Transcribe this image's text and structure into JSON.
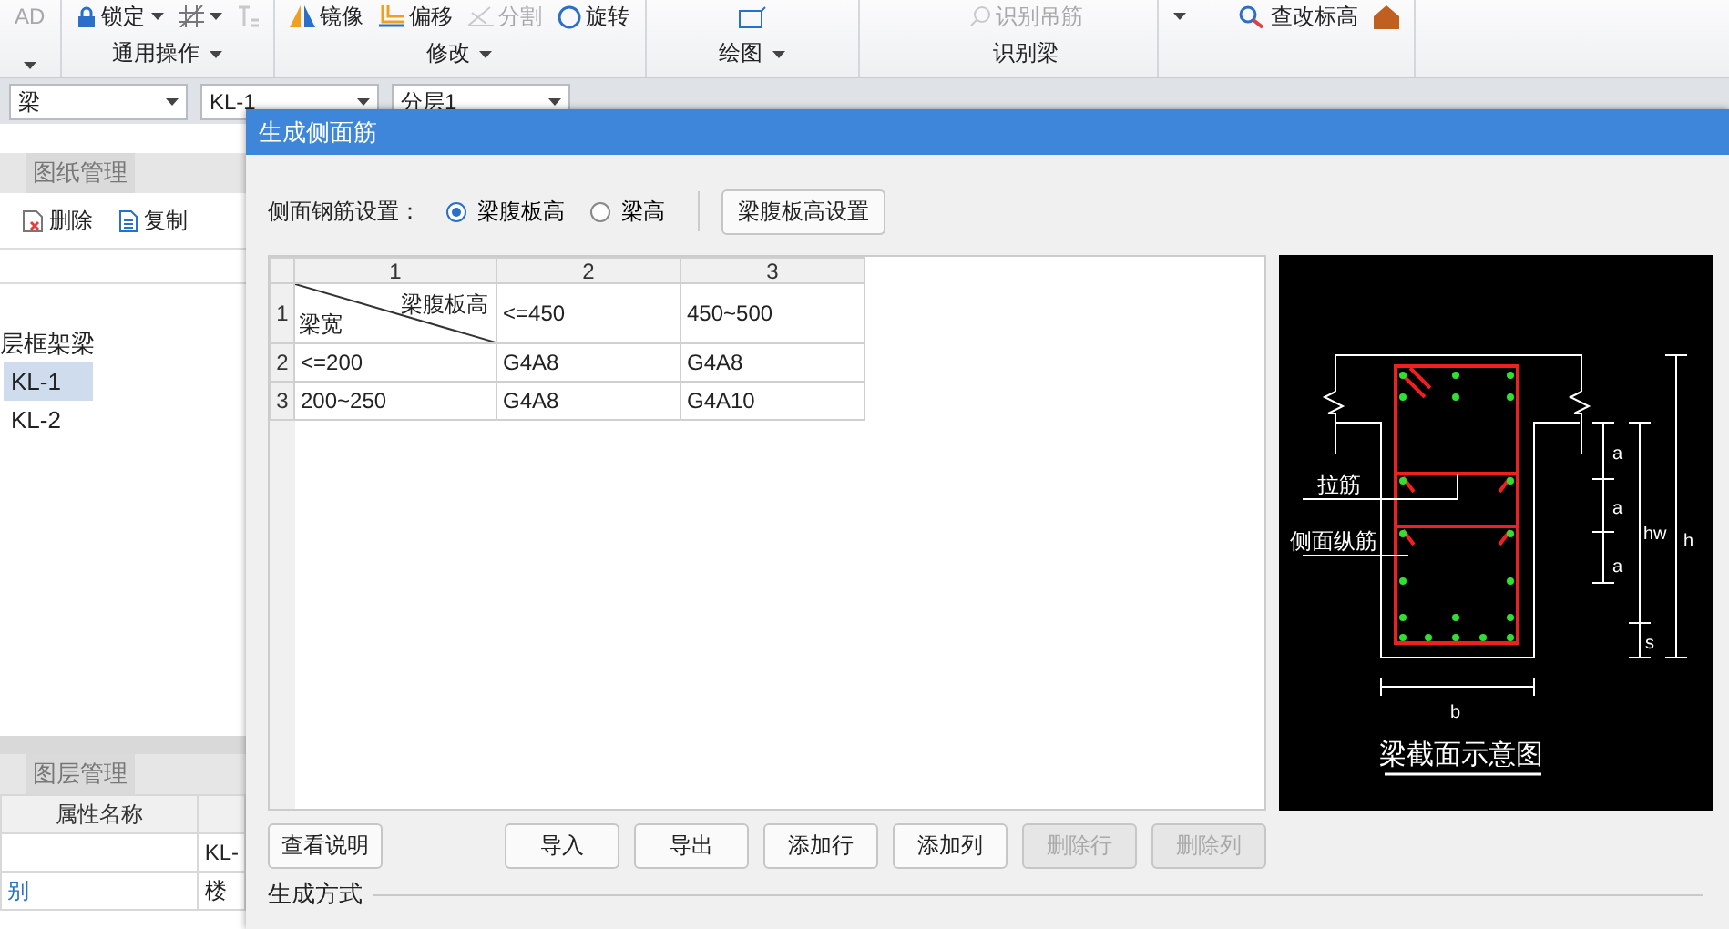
{
  "ribbon_groups": [
    {
      "tools": [
        {
          "kind": "labeled",
          "label": "AD",
          "disabled": true
        }
      ],
      "menu": true
    },
    {
      "label": "通用操作",
      "menu": true,
      "tools": [
        {
          "kind": "labeled",
          "label": "锁定",
          "disabled": false,
          "menu": true
        },
        {
          "kind": "icon",
          "disabled": false,
          "menu": true
        },
        {
          "kind": "icon",
          "disabled": true
        }
      ]
    },
    {
      "label": "修改",
      "menu": true,
      "tools": [
        {
          "kind": "labeled",
          "label": "镜像",
          "disabled": false
        },
        {
          "kind": "labeled",
          "label": "偏移",
          "disabled": false
        },
        {
          "kind": "labeled",
          "label": "分割",
          "disabled": true
        },
        {
          "kind": "labeled",
          "label": "旋转",
          "disabled": false
        }
      ]
    },
    {
      "label": "绘图",
      "menu": true,
      "tools": [
        {
          "kind": "icon",
          "disabled": false
        }
      ]
    },
    {
      "label": "识别梁",
      "tools": [
        {
          "kind": "labeled",
          "label": "识别吊筋",
          "disabled": true
        }
      ]
    },
    {
      "tools": [
        {
          "kind": "menu",
          "disabled": false,
          "menu": true
        },
        {
          "kind": "labeled",
          "label": "查改标高",
          "disabled": false
        },
        {
          "kind": "icon",
          "disabled": false
        }
      ]
    }
  ],
  "selectors": [
    "梁",
    "KL-1",
    "分层1"
  ],
  "drawing_panel": {
    "tab": "图纸管理",
    "tools": [
      "删除",
      "复制"
    ]
  },
  "tree": [
    {
      "label": "层框架梁",
      "selected": false,
      "children": [
        {
          "label": "KL-1",
          "selected": true
        },
        {
          "label": "KL-2",
          "selected": false
        }
      ]
    }
  ],
  "layer_panel": {
    "tab": "图层管理",
    "columns": [
      "属性名称"
    ],
    "rows": [
      {
        "value": "KL-"
      },
      {
        "name": "别",
        "value": "楼"
      }
    ]
  },
  "dialog": {
    "title": "生成侧面筋",
    "setting_label": "侧面钢筋设置：",
    "options": [
      {
        "label": "梁腹板高",
        "selected": true
      },
      {
        "label": "梁高",
        "selected": false
      }
    ],
    "settings_button": "梁腹板高设置",
    "grid": {
      "column_numbers": [
        "1",
        "2",
        "3"
      ],
      "corner": {
        "top": "梁腹板高",
        "bottom": "梁宽"
      },
      "header_row": {
        "number": "1",
        "cells": [
          "<=450",
          "450~500"
        ]
      },
      "rows": [
        {
          "number": "2",
          "cells": [
            "<=200",
            "G4A8",
            "G4A8"
          ]
        },
        {
          "number": "3",
          "cells": [
            "200~250",
            "G4A8",
            "G4A10"
          ]
        }
      ]
    },
    "diagram": {
      "tie_label": "拉筋",
      "side_bar_label": "侧面纵筋",
      "spacing_labels": [
        "a",
        "a",
        "a"
      ],
      "web_height_label": "hw",
      "height_label": "h",
      "cover_label": "s",
      "width_label": "b",
      "caption": "梁截面示意图"
    },
    "help_button": "查看说明",
    "buttons": [
      {
        "label": "导入",
        "disabled": false
      },
      {
        "label": "导出",
        "disabled": false
      },
      {
        "label": "添加行",
        "disabled": false
      },
      {
        "label": "添加列",
        "disabled": false
      },
      {
        "label": "删除行",
        "disabled": true
      },
      {
        "label": "删除列",
        "disabled": true
      }
    ],
    "section_title": "生成方式"
  }
}
